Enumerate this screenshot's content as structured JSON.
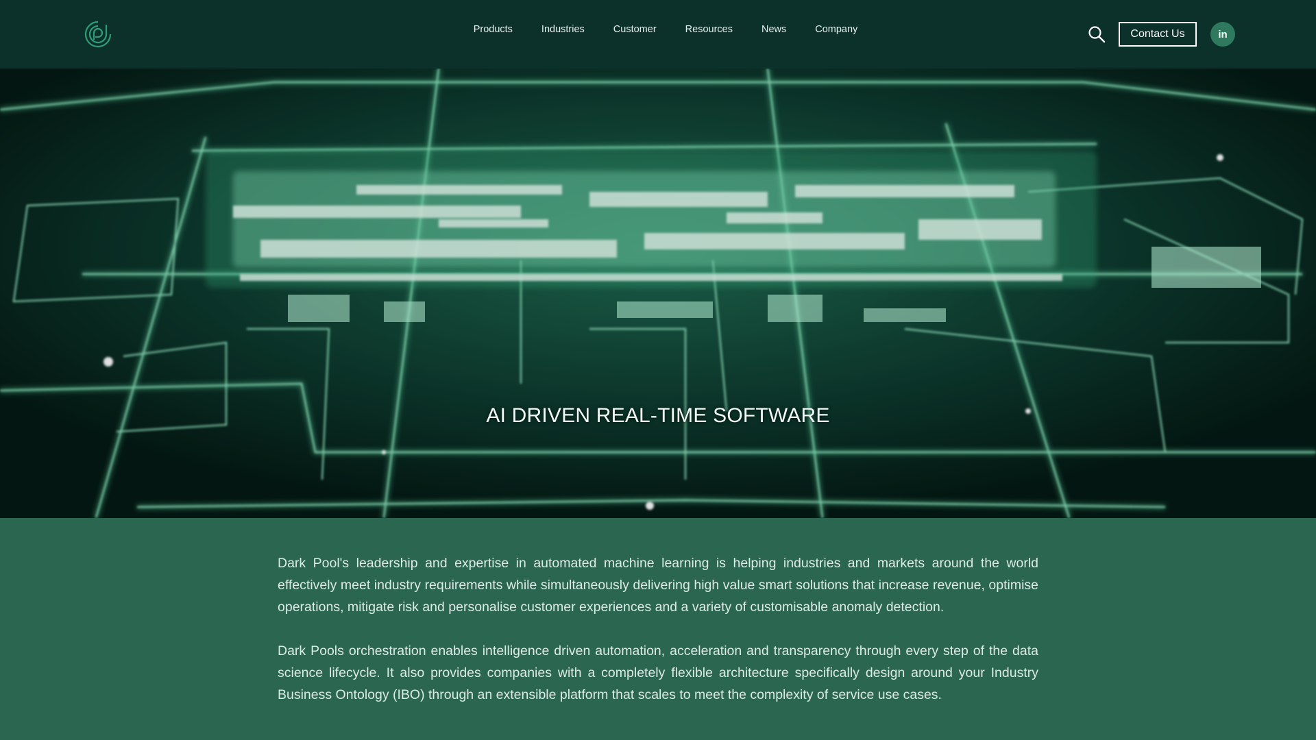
{
  "brand": {
    "logo_icon": "darkpool-logo-icon",
    "accent": "#2f9e77"
  },
  "nav": {
    "items": [
      {
        "label": "Products"
      },
      {
        "label": "Industries"
      },
      {
        "label": "Customer"
      },
      {
        "label": "Resources"
      },
      {
        "label": "News"
      },
      {
        "label": "Company"
      }
    ],
    "search_icon": "search-icon",
    "contact_label": "Contact Us",
    "social_label": "in",
    "social_icon": "linkedin-icon"
  },
  "hero": {
    "title": "AI DRIVEN REAL-TIME SOFTWARE",
    "image": "glowing-circuit-board-image"
  },
  "content": {
    "paragraphs": [
      "Dark Pool's leadership and expertise in automated machine learning is helping industries and markets around the world effectively meet industry requirements while simultaneously delivering high value smart solutions that increase revenue, optimise operations, mitigate risk and personalise customer experiences and a variety of customisable anomaly detection.",
      "Dark Pools orchestration enables intelligence driven automation, acceleration and transparency through every step of the data science lifecycle. It also provides companies with a completely flexible architecture specifically design around your Industry Business Ontology (IBO) through an extensible platform that scales to meet the complexity of service use cases."
    ]
  },
  "colors": {
    "header_bg": "#0c312a",
    "page_bg": "#2a6650",
    "glow": "#7ff0c0"
  }
}
